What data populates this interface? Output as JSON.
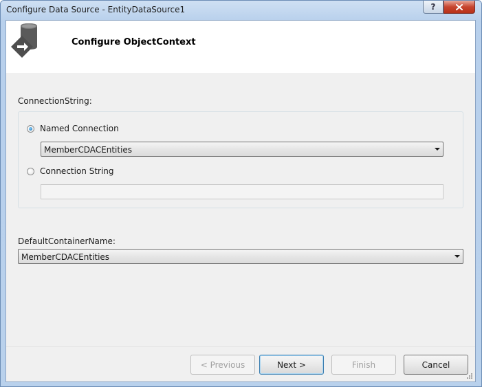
{
  "window": {
    "title": "Configure Data Source - EntityDataSource1",
    "help_glyph": "?",
    "close_glyph": "×"
  },
  "header": {
    "title": "Configure ObjectContext",
    "icon": "database-wizard-icon"
  },
  "connection": {
    "section_label": "ConnectionString:",
    "named_option_label": "Named Connection",
    "named_value": "MemberCDACEntities",
    "string_option_label": "Connection String",
    "string_value": "",
    "selected": "named"
  },
  "container": {
    "label": "DefaultContainerName:",
    "value": "MemberCDACEntities"
  },
  "buttons": {
    "previous": "< Previous",
    "next": "Next >",
    "finish": "Finish",
    "cancel": "Cancel"
  },
  "colors": {
    "title_bar": "#b9d1ec",
    "close_button": "#c7452f",
    "client_background": "#f0f0f0",
    "header_background": "#ffffff"
  }
}
